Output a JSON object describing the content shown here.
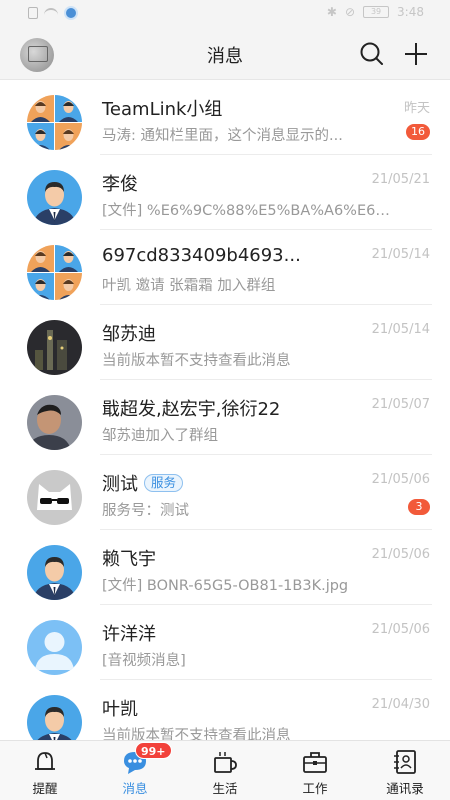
{
  "status_bar": {
    "battery": "39",
    "time": "3:48"
  },
  "header": {
    "title": "消息"
  },
  "conversations": [
    {
      "name": "TeamLink小组",
      "tag": "",
      "preview": "马涛: 通知栏里面，这个消息显示的...",
      "time": "昨天",
      "badge": "16",
      "avatar": "group"
    },
    {
      "name": "李俊",
      "tag": "",
      "preview": "[文件] %E6%9C%88%E5%BA%A6%E6%B1...",
      "time": "21/05/21",
      "badge": "",
      "avatar": "man"
    },
    {
      "name": "697cd833409b4693...",
      "tag": "",
      "preview": "叶凯 邀请 张霜霜 加入群组",
      "time": "21/05/14",
      "badge": "",
      "avatar": "group"
    },
    {
      "name": "邹苏迪",
      "tag": "",
      "preview": "当前版本暂不支持查看此消息",
      "time": "21/05/14",
      "badge": "",
      "avatar": "photo-night"
    },
    {
      "name": "戢超发,赵宏宇,徐衍22",
      "tag": "",
      "preview": "邹苏迪加入了群组",
      "time": "21/05/07",
      "badge": "",
      "avatar": "photo-man"
    },
    {
      "name": "测试",
      "tag": "服务",
      "preview": "服务号：测试",
      "time": "21/05/06",
      "badge": "3",
      "avatar": "cat"
    },
    {
      "name": "赖飞宇",
      "tag": "",
      "preview": "[文件] BONR-65G5-OB81-1B3K.jpg",
      "time": "21/05/06",
      "badge": "",
      "avatar": "man"
    },
    {
      "name": "许洋洋",
      "tag": "",
      "preview": "[音视频消息]",
      "time": "21/05/06",
      "badge": "",
      "avatar": "default"
    },
    {
      "name": "叶凯",
      "tag": "",
      "preview": "当前版本暂不支持查看此消息",
      "time": "21/04/30",
      "badge": "",
      "avatar": "man"
    }
  ],
  "tabs": [
    {
      "label": "提醒",
      "icon": "bell-icon",
      "badge": ""
    },
    {
      "label": "消息",
      "icon": "chat-bubble-icon",
      "badge": "99+"
    },
    {
      "label": "生活",
      "icon": "cup-icon",
      "badge": ""
    },
    {
      "label": "工作",
      "icon": "briefcase-icon",
      "badge": ""
    },
    {
      "label": "通讯录",
      "icon": "contacts-icon",
      "badge": ""
    }
  ],
  "colors": {
    "accent": "#3a8fe0",
    "badge": "#f25a3a"
  }
}
